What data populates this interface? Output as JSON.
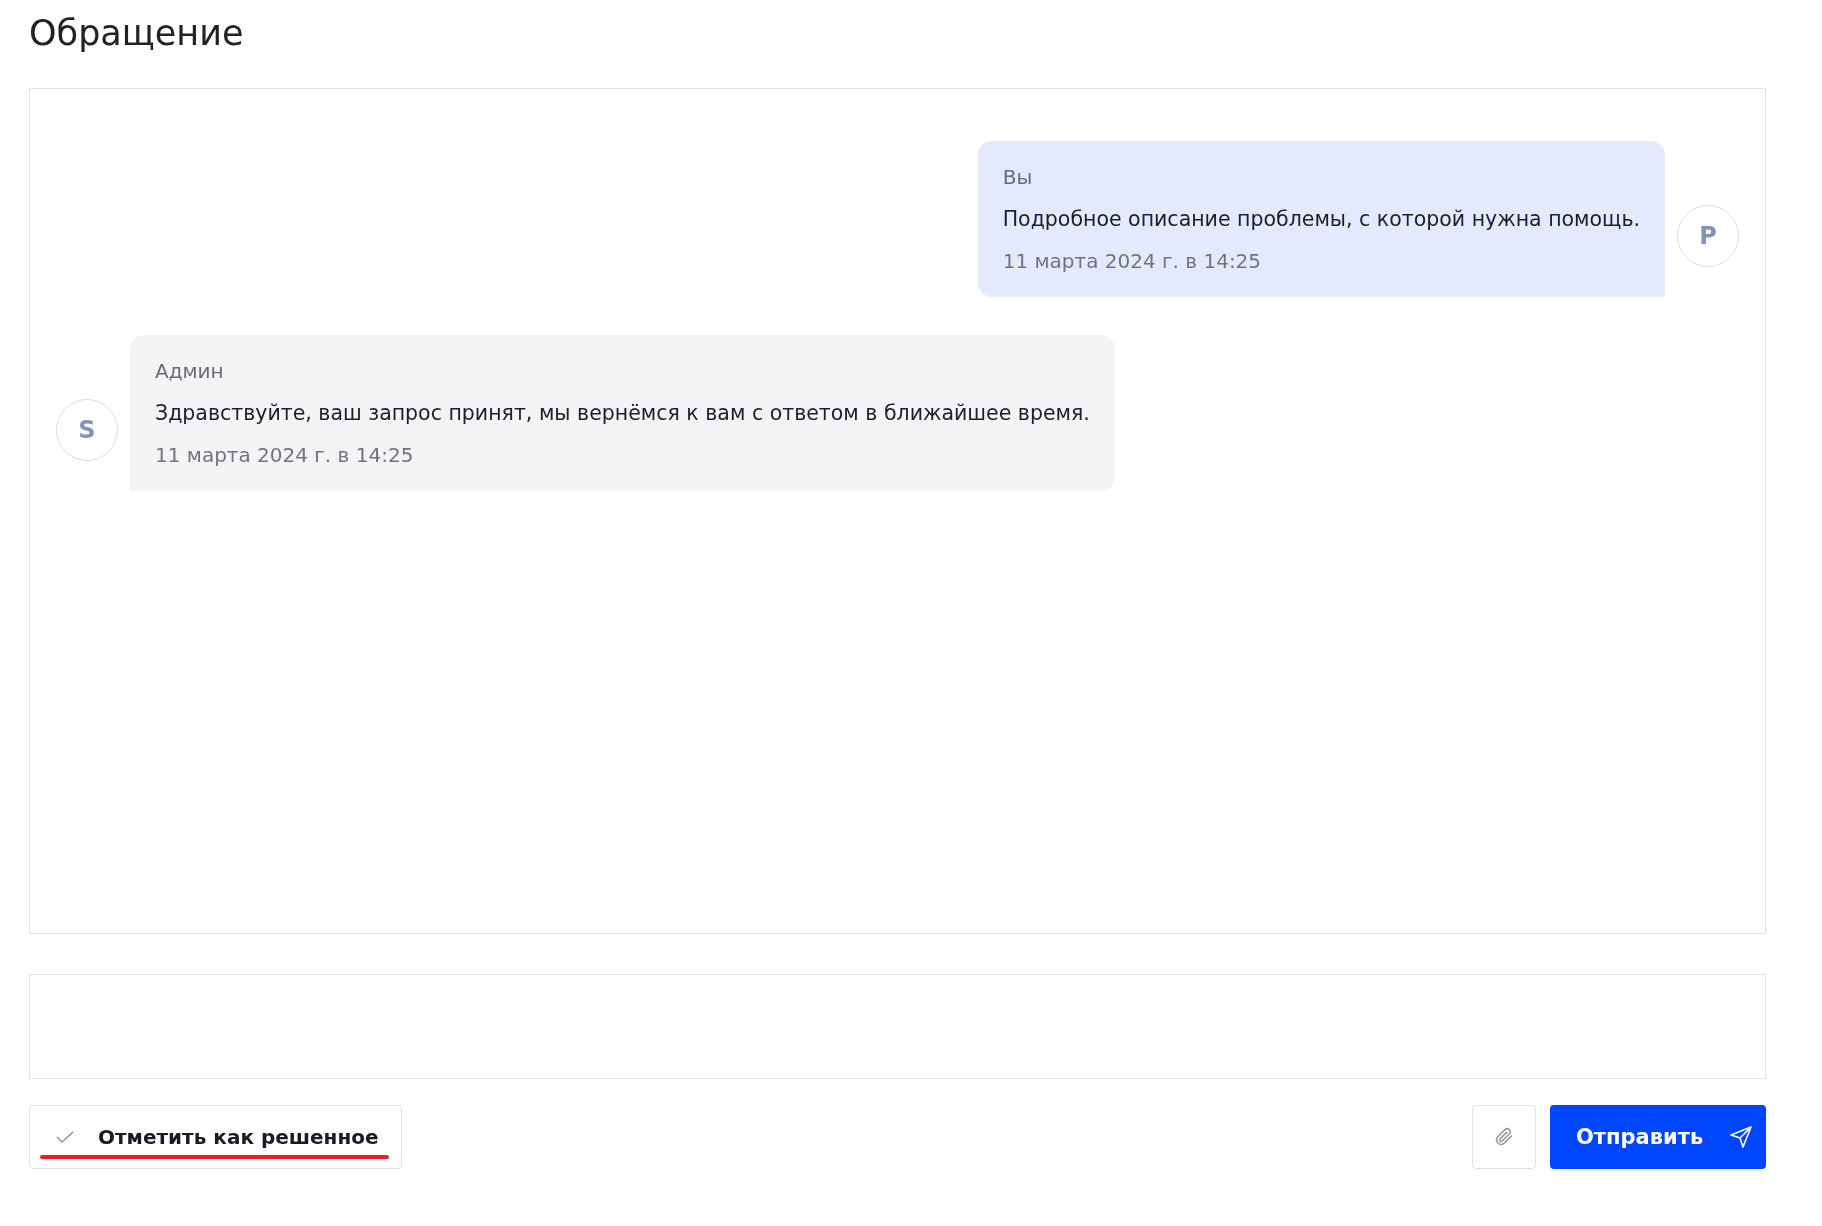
{
  "page": {
    "title": "Обращение"
  },
  "messages": [
    {
      "kind": "outgoing",
      "author": "Вы",
      "text": "Подробное описание проблемы, с которой нужна помощь.",
      "time": "11 марта 2024 г. в 14:25",
      "avatar": "P"
    },
    {
      "kind": "incoming",
      "author": "Админ",
      "text": "Здравствуйте, ваш запрос принят, мы вернёмся к вам с ответом в ближайшее время.",
      "time": "11 марта 2024 г. в 14:25",
      "avatar": "S"
    }
  ],
  "actions": {
    "resolve_label": "Отметить как решенное",
    "send_label": "Отправить"
  }
}
